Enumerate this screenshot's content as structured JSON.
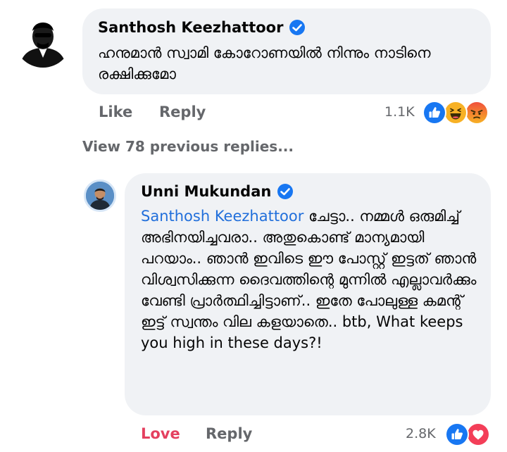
{
  "comment": {
    "author": "Santhosh Keezhattoor",
    "text": "ഹനുമാൻ സ്വാമി കോറോണയിൽ നിന്നും നാടിനെ രക്ഷിക്കുമോ",
    "actions": {
      "like": "Like",
      "reply": "Reply"
    },
    "reaction_count": "1.1K",
    "reactions": [
      "like-icon",
      "haha-icon",
      "angry-icon"
    ]
  },
  "view_previous": "View 78 previous replies...",
  "reply": {
    "author": "Unni Mukundan",
    "mention": "Santhosh Keezhattoor",
    "text": " ചേട്ടാ.. നമ്മൾ ഒരുമിച്ച് അഭിനയിച്ചവരാ.. അതുകൊണ്ട് മാന്യമായി പറയാം.. ഞാൻ ഇവിടെ ഈ പോസ്റ്റ് ഇട്ടത് ഞാൻ വിശ്വസിക്കുന്ന ദൈവത്തിന്റെ മുന്നിൽ എല്ലാവർക്കും വേണ്ടി പ്രാർത്ഥിച്ചിട്ടാണ്.. ഇതേ പോലുള്ള കമന്റ് ഇട്ട് സ്വന്തം വില കളയാതെ.. btb, What keeps you high in these days?!",
    "actions": {
      "love": "Love",
      "reply": "Reply"
    },
    "reaction_count": "2.8K",
    "reactions": [
      "like-icon",
      "love-icon"
    ]
  },
  "colors": {
    "bubble": "#f0f2f5",
    "mention": "#216fdb",
    "love": "#e4405f",
    "muted": "#65676b",
    "verified": "#1877f2"
  }
}
